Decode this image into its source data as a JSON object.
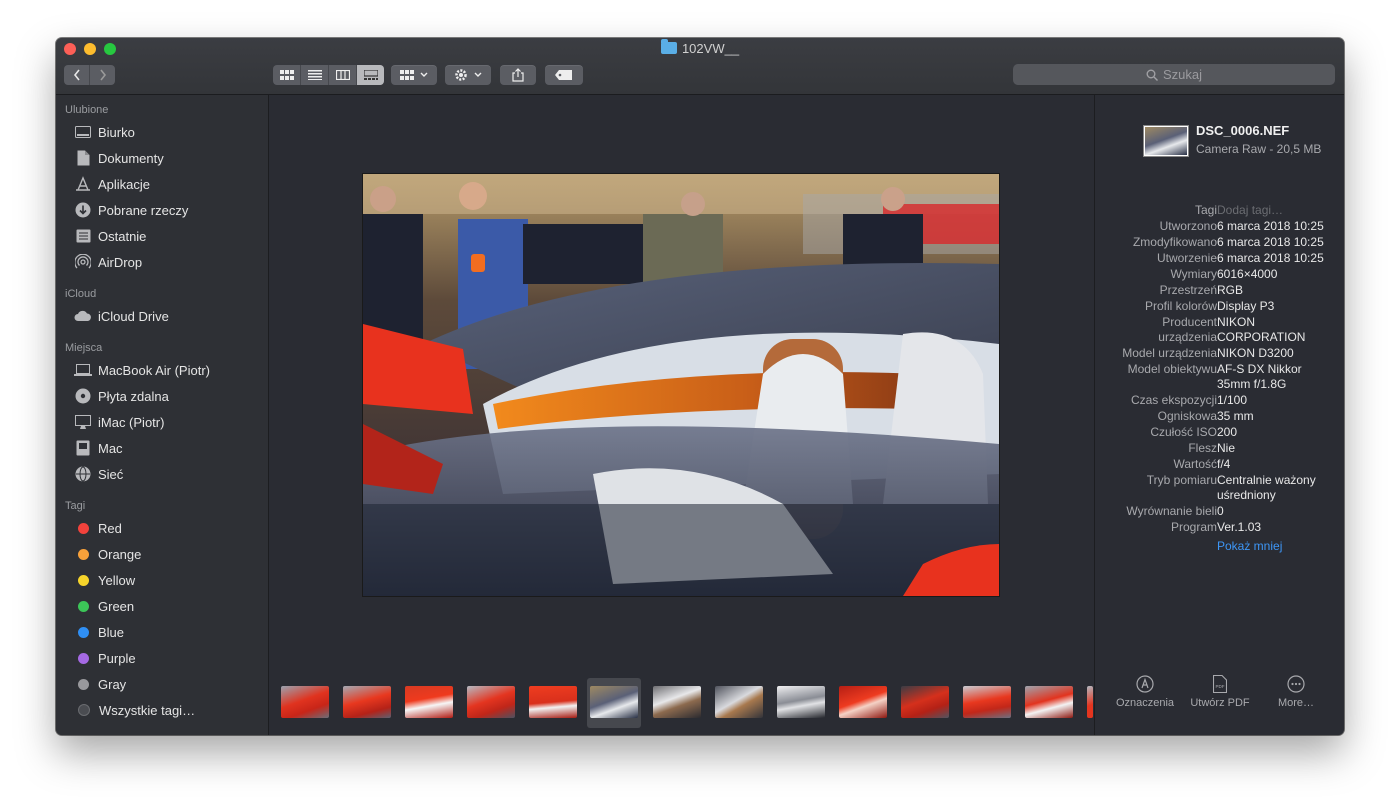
{
  "window": {
    "title": "102VW__",
    "search_placeholder": "Szukaj"
  },
  "sidebar": {
    "sections": [
      {
        "title": "Ulubione",
        "items": [
          {
            "label": "Biurko",
            "icon": "desktop-icon"
          },
          {
            "label": "Dokumenty",
            "icon": "documents-icon"
          },
          {
            "label": "Aplikacje",
            "icon": "applications-icon"
          },
          {
            "label": "Pobrane rzeczy",
            "icon": "downloads-icon"
          },
          {
            "label": "Ostatnie",
            "icon": "recents-icon"
          },
          {
            "label": "AirDrop",
            "icon": "airdrop-icon"
          }
        ]
      },
      {
        "title": "iCloud",
        "items": [
          {
            "label": "iCloud Drive",
            "icon": "cloud-icon"
          }
        ]
      },
      {
        "title": "Miejsca",
        "items": [
          {
            "label": "MacBook Air (Piotr)",
            "icon": "laptop-icon"
          },
          {
            "label": "Płyta zdalna",
            "icon": "disc-icon"
          },
          {
            "label": "iMac (Piotr)",
            "icon": "monitor-icon"
          },
          {
            "label": "Mac",
            "icon": "mac-icon"
          },
          {
            "label": "Sieć",
            "icon": "network-icon"
          }
        ]
      },
      {
        "title": "Tagi",
        "items": [
          {
            "label": "Red",
            "color": "#f2423c"
          },
          {
            "label": "Orange",
            "color": "#f8a13a"
          },
          {
            "label": "Yellow",
            "color": "#f6d42b"
          },
          {
            "label": "Green",
            "color": "#3cc558"
          },
          {
            "label": "Blue",
            "color": "#2f8ff5"
          },
          {
            "label": "Purple",
            "color": "#a569e4"
          },
          {
            "label": "Gray",
            "color": "#98989c"
          },
          {
            "label": "Wszystkie tagi…",
            "color": "#4a4c51"
          }
        ]
      }
    ]
  },
  "inspector": {
    "file_name": "DSC_0006.NEF",
    "file_sub": "Camera Raw - 20,5 MB",
    "rows": [
      {
        "k": "Tagi",
        "v": "Dodaj tagi…",
        "placeholder": true
      },
      {
        "k": "Utworzono",
        "v": "6 marca 2018 10:25"
      },
      {
        "k": "Zmodyfikowano",
        "v": "6 marca 2018 10:25"
      },
      {
        "k": "Utworzenie",
        "v": "6 marca 2018 10:25"
      },
      {
        "k": "Wymiary",
        "v": "6016×4000"
      },
      {
        "k": "Przestrzeń",
        "v": "RGB"
      },
      {
        "k": "Profil kolorów",
        "v": "Display P3"
      },
      {
        "k": "Producent urządzenia",
        "v": "NIKON CORPORATION"
      },
      {
        "k": "Model urządzenia",
        "v": "NIKON D3200"
      },
      {
        "k": "Model obiektywu",
        "v": "AF-S DX Nikkor 35mm f/1.8G"
      },
      {
        "k": "Czas ekspozycji",
        "v": "1/100"
      },
      {
        "k": "Ogniskowa",
        "v": "35 mm"
      },
      {
        "k": "Czułość ISO",
        "v": "200"
      },
      {
        "k": "Flesz",
        "v": "Nie"
      },
      {
        "k": "Wartość",
        "v": "f/4"
      },
      {
        "k": "Tryb pomiaru",
        "v": "Centralnie ważony uśredniony"
      },
      {
        "k": "Wyrównanie bieli",
        "v": "0"
      },
      {
        "k": "Program",
        "v": "Ver.1.03"
      }
    ],
    "show_less": "Pokaż mniej",
    "actions": [
      {
        "label": "Oznaczenia",
        "icon": "markup-icon"
      },
      {
        "label": "Utwórz PDF",
        "icon": "pdf-icon"
      },
      {
        "label": "More…",
        "icon": "more-icon"
      }
    ]
  },
  "thumbnails": {
    "selected_index": 5,
    "count": 14
  }
}
